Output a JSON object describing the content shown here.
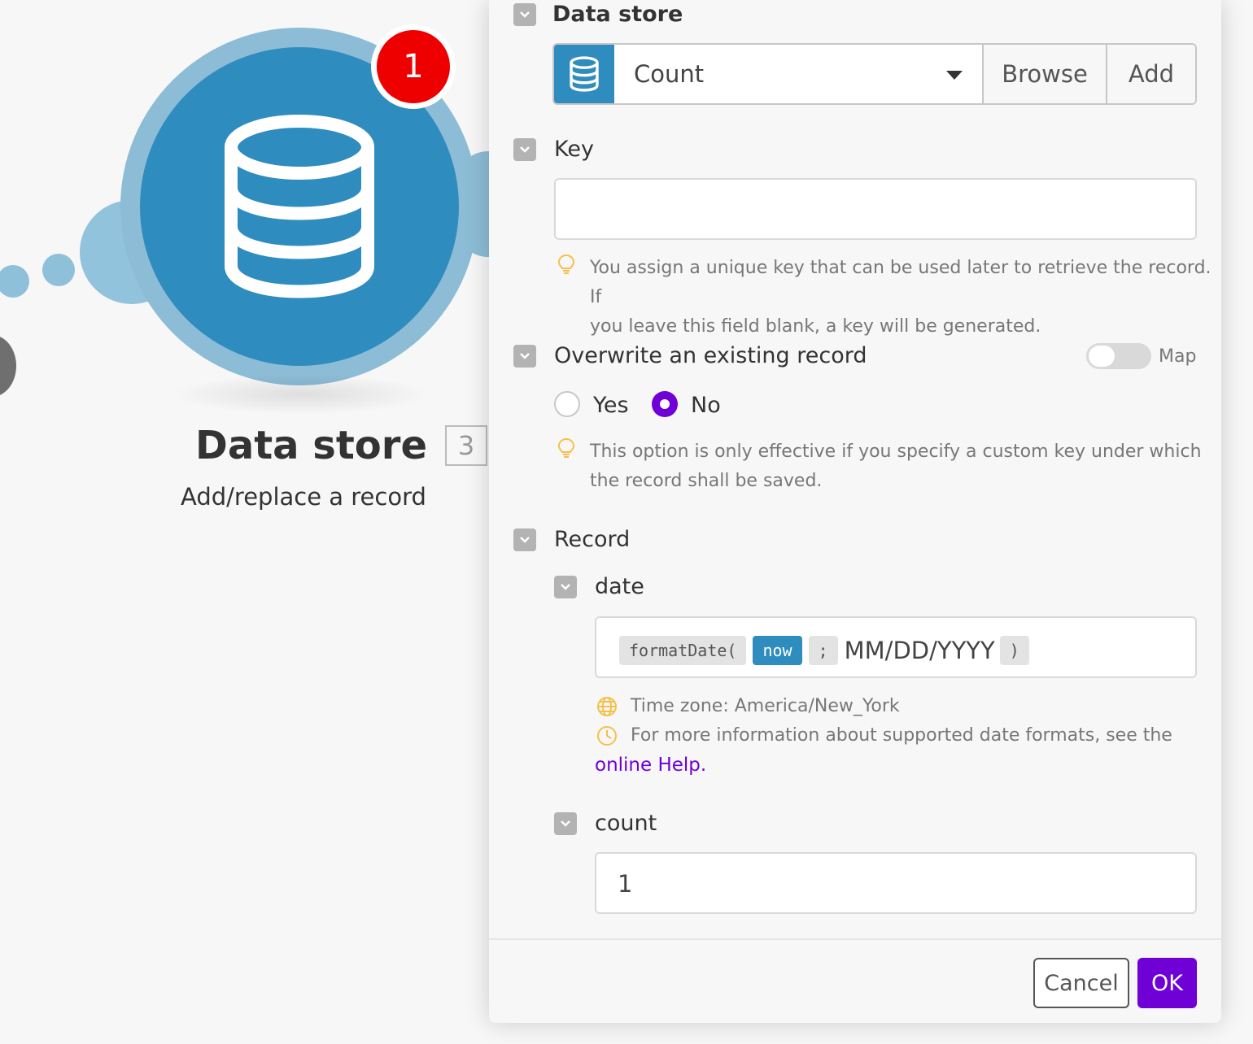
{
  "module": {
    "badge_count": "1",
    "title": "Data store",
    "id": "3",
    "subtitle": "Add/replace a record"
  },
  "panel": {
    "data_store": {
      "label": "Data store",
      "selected": "Count",
      "browse_label": "Browse",
      "add_label": "Add"
    },
    "key": {
      "label": "Key",
      "value": "",
      "hint_line1": "You assign a unique key that can be used later to retrieve the record. If",
      "hint_line2": "you leave this field blank, a key will be generated."
    },
    "overwrite": {
      "label": "Overwrite an existing record",
      "map_label": "Map",
      "map_enabled": false,
      "options": [
        "Yes",
        "No"
      ],
      "selected": "No",
      "hint_line1": "This option is only effective if you specify a custom key under which",
      "hint_line2": "the record shall be saved."
    },
    "record": {
      "label": "Record",
      "date": {
        "label": "date",
        "formula_fn": "formatDate(",
        "formula_arg": "now",
        "formula_sep": ";",
        "formula_text": "MM/DD/YYYY",
        "formula_close": ")",
        "timezone": "Time zone: America/New_York",
        "help_text": "For more information about supported date formats, see the",
        "help_link": "online Help",
        "help_end": "."
      },
      "count": {
        "label": "count",
        "value": "1"
      }
    },
    "footer": {
      "cancel_label": "Cancel",
      "ok_label": "OK"
    }
  },
  "colors": {
    "accent": "#6f00d6",
    "module_blue": "#2f8cbf",
    "badge_red": "#ee0000"
  }
}
